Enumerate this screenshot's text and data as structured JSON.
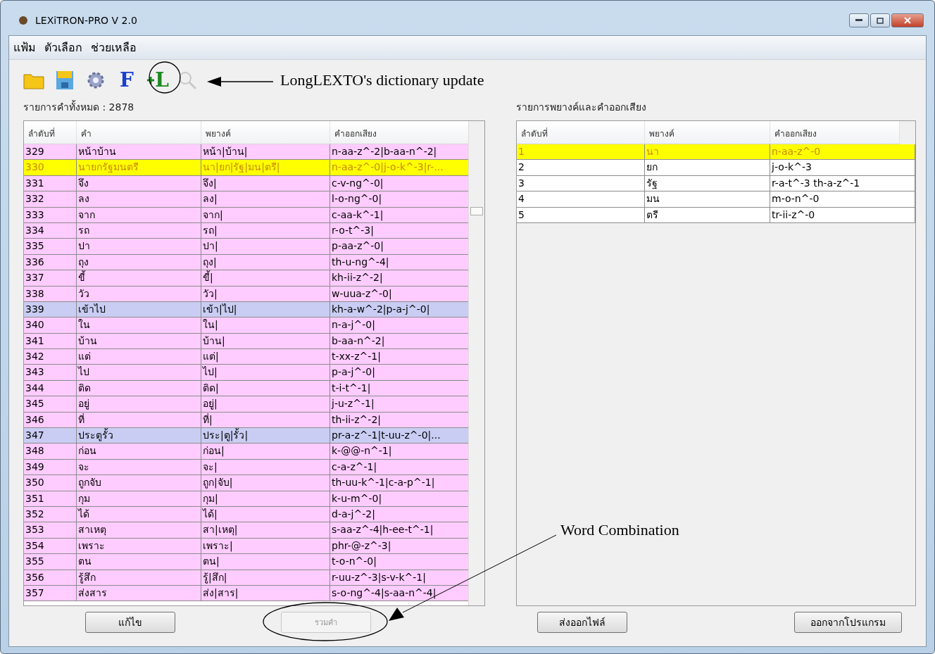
{
  "window": {
    "title": "LEXiTRON-PRO V 2.0"
  },
  "menu": [
    {
      "label": "แฟ้ม"
    },
    {
      "label": "ตัวเลือก"
    },
    {
      "label": "ช่วยเหลือ"
    }
  ],
  "toolbar": [
    {
      "kind": "folder",
      "disabled": false
    },
    {
      "kind": "save",
      "disabled": false
    },
    {
      "kind": "settings",
      "disabled": false
    },
    {
      "kind": "font",
      "glyph": "F",
      "disabled": false
    },
    {
      "kind": "add",
      "glyph": "L",
      "disabled": false
    },
    {
      "kind": "search",
      "disabled": true
    }
  ],
  "annotations": [
    {
      "kind": "circle-arrow",
      "text": "LongLEXTO's dictionary update"
    },
    {
      "kind": "ellipse-line",
      "text": "Word Combination"
    }
  ],
  "left": {
    "label": "รายการคำทั้งหมด : 2878",
    "columns": [
      "ลำดับที่",
      "คำ",
      "พยางค์",
      "คำออกเสียง"
    ],
    "rows": [
      {
        "cells": [
          "329",
          "หน้าบ้าน",
          "หน้า|บ้าน|",
          "n-aa-z^-2|b-aa-n^-2|"
        ],
        "selected": false,
        "highlighted": false
      },
      {
        "cells": [
          "330",
          "นายกรัฐมนตรี",
          "นา|ยก|รัฐ|มน|ตรี|",
          "n-aa-z^-0|j-o-k^-3|r-..."
        ],
        "selected": true,
        "highlighted": false
      },
      {
        "cells": [
          "331",
          "จึง",
          "จึง|",
          "c-v-ng^-0|"
        ],
        "selected": false,
        "highlighted": false
      },
      {
        "cells": [
          "332",
          "ลง",
          "ลง|",
          "l-o-ng^-0|"
        ],
        "selected": false,
        "highlighted": false
      },
      {
        "cells": [
          "333",
          "จาก",
          "จาก|",
          "c-aa-k^-1|"
        ],
        "selected": false,
        "highlighted": false
      },
      {
        "cells": [
          "334",
          "รถ",
          "รถ|",
          "r-o-t^-3|"
        ],
        "selected": false,
        "highlighted": false
      },
      {
        "cells": [
          "335",
          "ปา",
          "ปา|",
          "p-aa-z^-0|"
        ],
        "selected": false,
        "highlighted": false
      },
      {
        "cells": [
          "336",
          "ถุง",
          "ถุง|",
          "th-u-ng^-4|"
        ],
        "selected": false,
        "highlighted": false
      },
      {
        "cells": [
          "337",
          "ขี้",
          "ขี้|",
          "kh-ii-z^-2|"
        ],
        "selected": false,
        "highlighted": false
      },
      {
        "cells": [
          "338",
          "วัว",
          "วัว|",
          "w-uua-z^-0|"
        ],
        "selected": false,
        "highlighted": false
      },
      {
        "cells": [
          "339",
          "เข้าไป",
          "เข้า|ไป|",
          "kh-a-w^-2|p-a-j^-0|"
        ],
        "selected": false,
        "highlighted": true
      },
      {
        "cells": [
          "340",
          "ใน",
          "ใน|",
          "n-a-j^-0|"
        ],
        "selected": false,
        "highlighted": false
      },
      {
        "cells": [
          "341",
          "บ้าน",
          "บ้าน|",
          "b-aa-n^-2|"
        ],
        "selected": false,
        "highlighted": false
      },
      {
        "cells": [
          "342",
          "แต่",
          "แต่|",
          "t-xx-z^-1|"
        ],
        "selected": false,
        "highlighted": false
      },
      {
        "cells": [
          "343",
          "ไป",
          "ไป|",
          "p-a-j^-0|"
        ],
        "selected": false,
        "highlighted": false
      },
      {
        "cells": [
          "344",
          "ติด",
          "ติด|",
          "t-i-t^-1|"
        ],
        "selected": false,
        "highlighted": false
      },
      {
        "cells": [
          "345",
          "อยู่",
          "อยู่|",
          "j-u-z^-1|"
        ],
        "selected": false,
        "highlighted": false
      },
      {
        "cells": [
          "346",
          "ที่",
          "ที่|",
          "th-ii-z^-2|"
        ],
        "selected": false,
        "highlighted": false
      },
      {
        "cells": [
          "347",
          "ประตูรั้ว",
          "ประ|ตู|รั้ว|",
          "pr-a-z^-1|t-uu-z^-0|..."
        ],
        "selected": false,
        "highlighted": true
      },
      {
        "cells": [
          "348",
          "ก่อน",
          "ก่อน|",
          "k-@@-n^-1|"
        ],
        "selected": false,
        "highlighted": false
      },
      {
        "cells": [
          "349",
          "จะ",
          "จะ|",
          "c-a-z^-1|"
        ],
        "selected": false,
        "highlighted": false
      },
      {
        "cells": [
          "350",
          "ถูกจับ",
          "ถูก|จับ|",
          "th-uu-k^-1|c-a-p^-1|"
        ],
        "selected": false,
        "highlighted": false
      },
      {
        "cells": [
          "351",
          "กุม",
          "กุม|",
          "k-u-m^-0|"
        ],
        "selected": false,
        "highlighted": false
      },
      {
        "cells": [
          "352",
          "ได้",
          "ได้|",
          "d-a-j^-2|"
        ],
        "selected": false,
        "highlighted": false
      },
      {
        "cells": [
          "353",
          "สาเหตุ",
          "สา|เหตุ|",
          "s-aa-z^-4|h-ee-t^-1|"
        ],
        "selected": false,
        "highlighted": false
      },
      {
        "cells": [
          "354",
          "เพราะ",
          "เพราะ|",
          "phr-@-z^-3|"
        ],
        "selected": false,
        "highlighted": false
      },
      {
        "cells": [
          "355",
          "ตน",
          "ตน|",
          "t-o-n^-0|"
        ],
        "selected": false,
        "highlighted": false
      },
      {
        "cells": [
          "356",
          "รู้สึก",
          "รู้|สึก|",
          "r-uu-z^-3|s-v-k^-1|"
        ],
        "selected": false,
        "highlighted": false
      },
      {
        "cells": [
          "357",
          "ส่งสาร",
          "ส่ง|สาร|",
          "s-o-ng^-4|s-aa-n^-4|"
        ],
        "selected": false,
        "highlighted": false
      }
    ],
    "buttons": [
      {
        "label": "แก้ไข",
        "disabled": false
      },
      {
        "label": "รวมคำ",
        "disabled": true
      }
    ]
  },
  "right": {
    "label": "รายการพยางค์และคำออกเสียง",
    "columns": [
      "ลำดับที่",
      "พยางค์",
      "คำออกเสียง"
    ],
    "rows": [
      {
        "cells": [
          "1",
          "นา",
          "n-aa-z^-0"
        ],
        "selected": true
      },
      {
        "cells": [
          "2",
          "ยก",
          "j-o-k^-3"
        ],
        "selected": false
      },
      {
        "cells": [
          "3",
          "รัฐ",
          "r-a-t^-3 th-a-z^-1"
        ],
        "selected": false
      },
      {
        "cells": [
          "4",
          "มน",
          "m-o-n^-0"
        ],
        "selected": false
      },
      {
        "cells": [
          "5",
          "ตรี",
          "tr-ii-z^-0"
        ],
        "selected": false
      }
    ],
    "buttons": [
      {
        "label": "ส่งออกไฟล์",
        "disabled": false
      },
      {
        "label": "ออกจากโปรแกรม",
        "disabled": false
      }
    ]
  }
}
